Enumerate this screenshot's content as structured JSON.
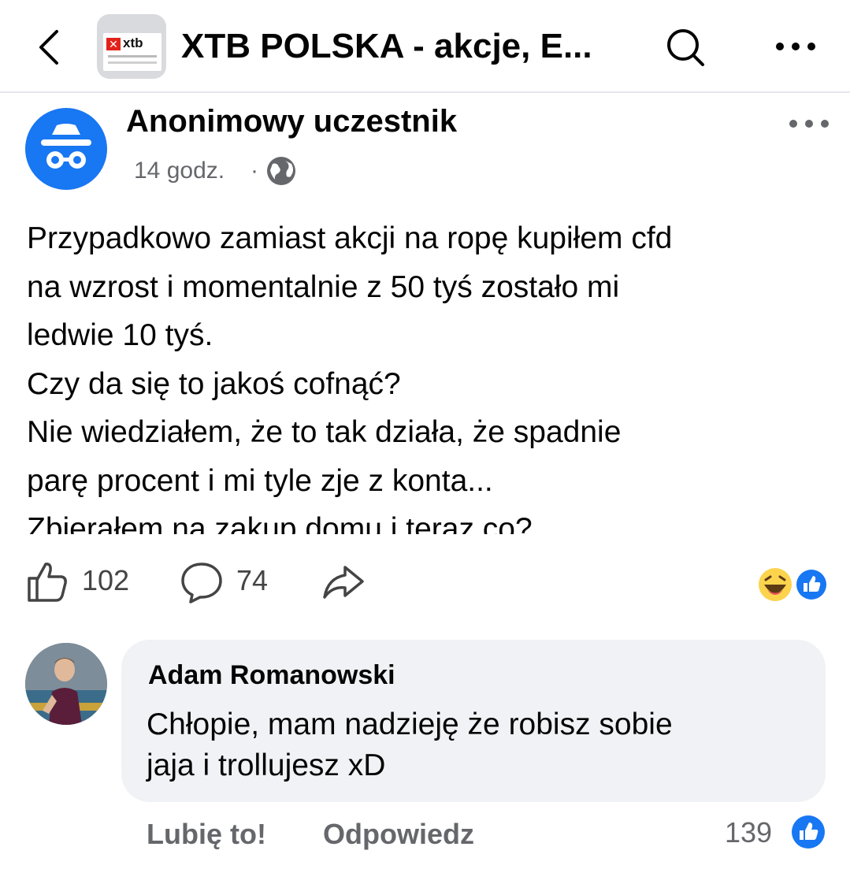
{
  "header": {
    "group_title": "XTB POLSKA - akcje, E...",
    "logo_text": "xtb",
    "back_icon": "chevron-left-icon",
    "search_icon": "search-icon",
    "more_icon": "more-horizontal-icon"
  },
  "post": {
    "author": "Anonimowy uczestnik",
    "avatar_icon": "anonymous-incognito-icon",
    "time": "14 godz.",
    "separator": "·",
    "audience_icon": "globe-icon",
    "body_lines": [
      "Przypadkowo zamiast akcji na ropę kupiłem cfd",
      "na wzrost i momentalnie z 50 tyś zostało mi",
      "ledwie 10 tyś.",
      "Czy da się to jakoś cofnąć?",
      "Nie wiedziałem, że to tak działa, że spadnie",
      "parę procent i mi tyle zje z konta...",
      "Zbierałem na zakup domu i teraz co?"
    ],
    "like_count": "102",
    "comment_count": "74",
    "reaction_icons": [
      "haha-reaction-icon",
      "like-reaction-icon"
    ]
  },
  "comment": {
    "author": "Adam Romanowski",
    "text_lines": [
      "Chłopie, mam nadzieję że robisz sobie",
      "jaja i trollujesz xD"
    ],
    "like_label": "Lubię to!",
    "reply_label": "Odpowiedz",
    "like_count": "139"
  },
  "colors": {
    "facebook_blue": "#1877f2",
    "secondary_text": "#65676b",
    "bubble_bg": "#f0f2f5",
    "xtb_red": "#e2231a"
  }
}
